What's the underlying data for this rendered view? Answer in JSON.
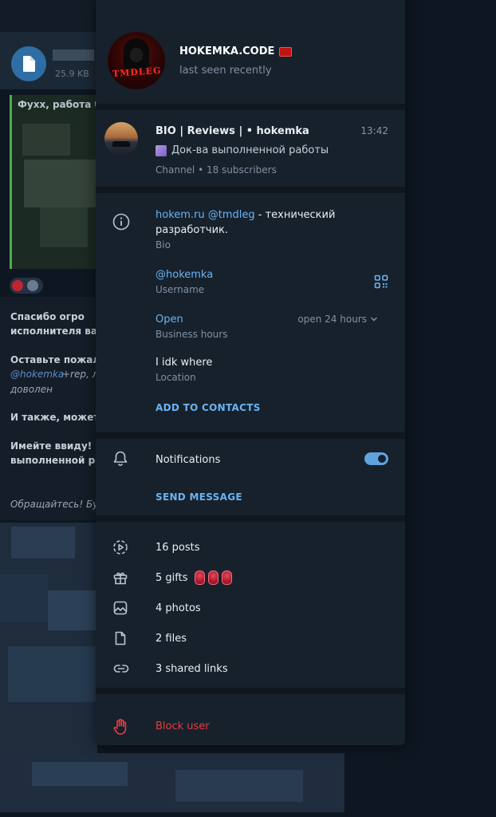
{
  "background_chat": {
    "file_size": "25.9 KB",
    "quote_title": "Фухх, работа б",
    "message_lines": [
      "Спасибо огро",
      "исполнителя ва",
      "Оставьте пожал",
      "+rep, л",
      "доволен",
      "И также, может",
      "Имейте ввиду! I",
      "выполненной ра",
      "Обращайтесь! Бу"
    ],
    "message_link": "@hokemka"
  },
  "profile": {
    "name": "HOKEMKA.CODE",
    "status": "last seen recently",
    "avatar_text": "TMDLEG"
  },
  "channel": {
    "name": "BIO | Reviews | • hokemka",
    "time": "13:42",
    "last_post": "Док-ва выполненной работы",
    "meta": "Channel • 18 subscribers"
  },
  "info": {
    "bio_link_1": "hokem.ru",
    "bio_link_2": "@tmdleg",
    "bio_text_1": " - технический",
    "bio_text_2": "разработчик.",
    "bio_label": "Bio",
    "username": "@hokemka",
    "username_label": "Username",
    "hours_value": "Open",
    "hours_label": "Business hours",
    "hours_right": "open 24 hours",
    "location_value": "I idk where",
    "location_label": "Location",
    "add_contact": "ADD TO CONTACTS"
  },
  "notifications": {
    "label": "Notifications",
    "enabled": true,
    "send_message": "SEND MESSAGE"
  },
  "media": {
    "posts": "16 posts",
    "gifts": "5 gifts",
    "photos": "4 photos",
    "files": "2 files",
    "links": "3 shared links"
  },
  "block": {
    "label": "Block user"
  },
  "colors": {
    "accent": "#6ab3f3",
    "danger": "#ec3942",
    "panel_bg": "#17212b",
    "page_bg": "#0e1621"
  }
}
